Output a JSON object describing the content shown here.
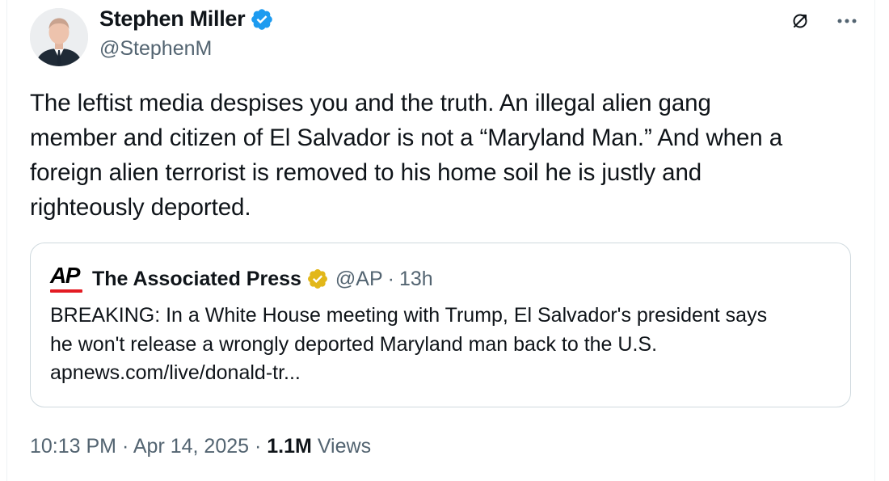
{
  "author": {
    "display_name": "Stephen Miller",
    "handle": "@StephenM",
    "verified_icon": "blue-check-icon"
  },
  "toolbar": {
    "icons": [
      "grok-icon",
      "more-options-icon"
    ],
    "more_label": "···"
  },
  "tweet": {
    "text": "The leftist media despises you and the truth. An illegal alien gang\nmember and citizen of El Salvador is not a “Maryland Man.” And when a\nforeign alien terrorist is removed to his home soil he is justly and\nrighteously deported."
  },
  "quote": {
    "logo_text": "AP",
    "display_name": "The Associated Press",
    "handle": "@AP",
    "separator": "·",
    "time": "13h",
    "text": "BREAKING: In a White House meeting with Trump, El Salvador's president says\nhe won't release a wrongly deported Maryland man back to the U.S.\napnews.com/live/donald-tr...",
    "badge_icon": "gold-check-icon"
  },
  "meta": {
    "time": "10:13 PM",
    "sep1": "·",
    "date": "Apr 14, 2025",
    "sep2": "·",
    "views_count": "1.1M",
    "views_label": "Views"
  },
  "colors": {
    "text": "#0f1419",
    "secondary": "#536471",
    "verified_blue": "#1d9bf0",
    "verified_gold": "#e2b719",
    "ap_red": "#e31b23",
    "border": "#cfd9de"
  }
}
